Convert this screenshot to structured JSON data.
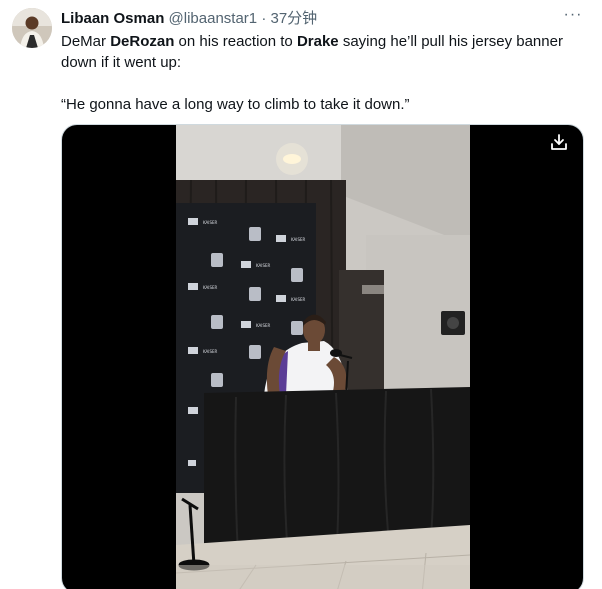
{
  "tweet": {
    "author": {
      "display_name": "Libaan Osman",
      "handle": "@libaanstar1",
      "separator": "·",
      "time": "37分钟"
    },
    "text": {
      "p1_a": "DeMar ",
      "p1_b": "DeRozan",
      "p1_c": " on his reaction to ",
      "p1_d": "Drake",
      "p1_e": " saying he’ll pull his jersey banner down if it went up:",
      "quote": "“He gonna have a long way to climb to take it down.”"
    },
    "more_label": "···"
  },
  "media": {
    "type": "video",
    "download_icon": "download-icon",
    "backdrop": {
      "brand": "Kings",
      "sponsor_line1": "KAISER",
      "sponsor_line2": "PERMANENTE."
    }
  },
  "colors": {
    "text_primary": "#0f1419",
    "text_secondary": "#536471",
    "media_bg": "#000000"
  }
}
